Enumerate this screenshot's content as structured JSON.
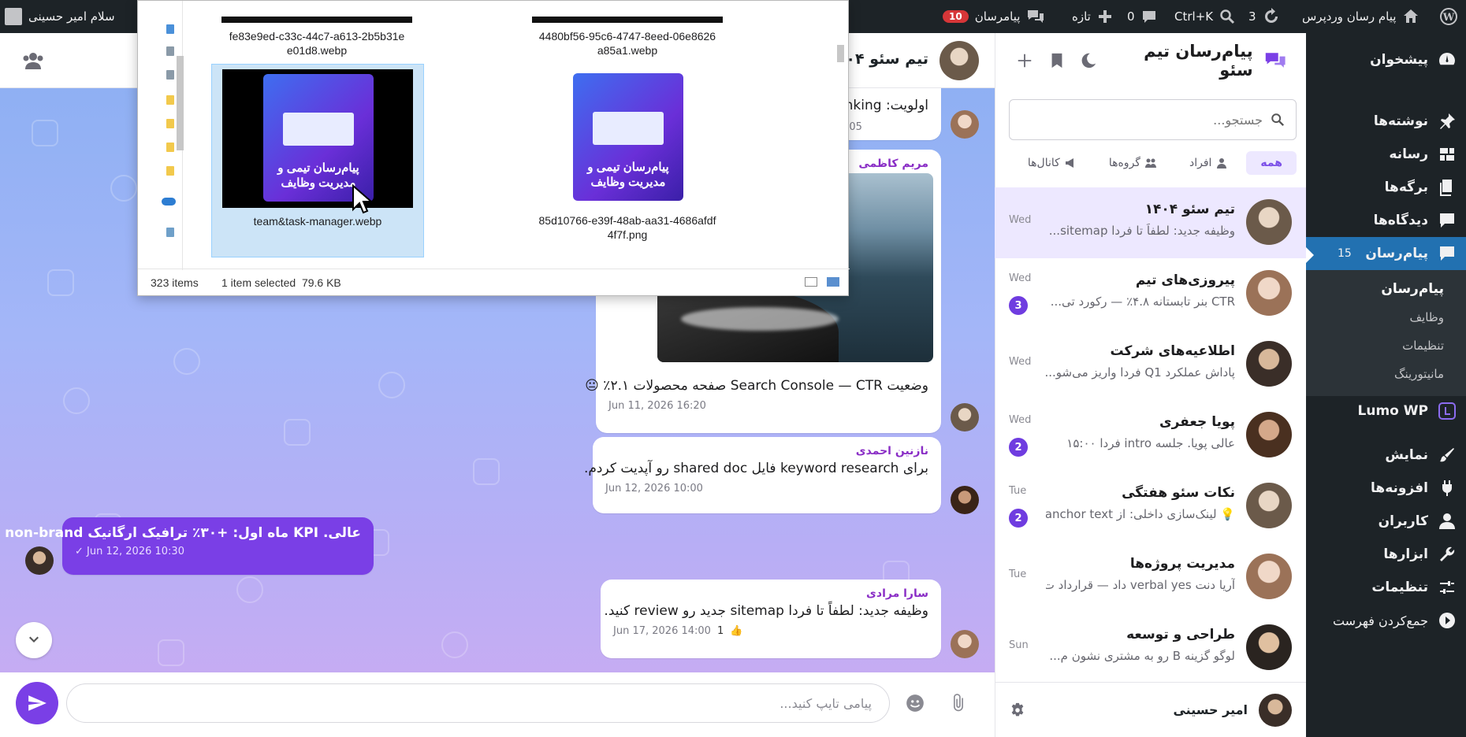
{
  "adminbar": {
    "site_name": "پیام رسان وردپرس",
    "updates_count": "3",
    "search_shortcut": "Ctrl+K",
    "comments_count": "0",
    "new_label": "تازه",
    "messenger_label": "پیامرسان",
    "messenger_badge": "10",
    "greeting": "سلام امیر حسینی"
  },
  "wp_menu": {
    "items": [
      {
        "label": "پیشخوان",
        "icon": "dashboard-icon"
      },
      {
        "label": "نوشته‌ها",
        "icon": "pin-icon"
      },
      {
        "label": "رسانه",
        "icon": "media-icon"
      },
      {
        "label": "برگه‌ها",
        "icon": "pages-icon"
      },
      {
        "label": "دیدگاه‌ها",
        "icon": "comments-icon"
      },
      {
        "label": "پیام‌رسان",
        "icon": "messenger-icon",
        "count": "15"
      },
      {
        "label": "Lumo WP",
        "icon": "lumo-icon"
      },
      {
        "label": "نمایش",
        "icon": "appearance-icon"
      },
      {
        "label": "افزونه‌ها",
        "icon": "plugins-icon"
      },
      {
        "label": "کاربران",
        "icon": "users-icon"
      },
      {
        "label": "ابزارها",
        "icon": "tools-icon"
      },
      {
        "label": "تنظیمات",
        "icon": "settings-icon"
      },
      {
        "label": "جمع‌کردن فهرست",
        "icon": "collapse-icon"
      }
    ],
    "submenu": [
      "پیام‌رسان",
      "وظایف",
      "تنظیمات",
      "مانیتورینگ"
    ]
  },
  "list_panel": {
    "title": "پیام‌رسان تیم سئو",
    "search_placeholder": "جستجو...",
    "tabs": [
      "همه",
      "افراد",
      "گروه‌ها",
      "کانال‌ها"
    ],
    "chats": [
      {
        "name": "تیم سئو ۱۴۰۴",
        "preview": "وظیفه جدید: لطفاً تا فردا sitemap...",
        "time": "Wed",
        "unread": ""
      },
      {
        "name": "پیروزی‌های تیم",
        "preview": "CTR بنر تابستانه ۴.۸٪ — رکورد تی...",
        "time": "Wed",
        "unread": "3"
      },
      {
        "name": "اطلاعیه‌های شرکت",
        "preview": "پاداش عملکرد Q1 فردا واریز می‌شو...",
        "time": "Wed",
        "unread": ""
      },
      {
        "name": "پویا جعفری",
        "preview": "عالی پویا. جلسه intro فردا ۱۵:۰۰",
        "time": "Wed",
        "unread": "2"
      },
      {
        "name": "نکات سئو هفتگی",
        "preview": "💡 لینک‌سازی داخلی: از anchor text...",
        "time": "Tue",
        "unread": "2"
      },
      {
        "name": "مدیریت پروژه‌ها",
        "preview": "آریا دنت verbal yes داد — قرارداد ت...",
        "time": "Tue",
        "unread": ""
      },
      {
        "name": "طراحی و توسعه",
        "preview": "لوگو گزینه B رو به مشتری نشون م...",
        "time": "Sun",
        "unread": ""
      }
    ],
    "me_name": "امیر حسینی"
  },
  "conversation": {
    "title": "تیم سئو ۱۴۰۴",
    "partial_text": "اولویت: Ranking",
    "partial_time": "Jun 10, 2026 08:05",
    "messages": [
      {
        "sender": "مریم کاظمی",
        "text": "وضعیت Search Console — CTR صفحه محصولات ۲.۱٪ 😐",
        "time": "Jun 11, 2026 16:20"
      },
      {
        "sender": "نازنین احمدی",
        "text": "برای keyword research فایل shared doc رو آپدیت کردم.",
        "time": "Jun 12, 2026 10:00"
      },
      {
        "sender": "",
        "text": "عالی. KPI ماه اول: +۳۰٪ ترافیک ارگانیک non-brand",
        "time": "Jun 12, 2026 10:30"
      },
      {
        "sender": "سارا مرادی",
        "text": "وظیفه جدید: لطفاً تا فردا sitemap جدید رو review کنید.",
        "time": "Jun 17, 2026 14:00",
        "reaction": "👍",
        "reaction_count": "1"
      }
    ],
    "composer_placeholder": "پیامی تایپ کنید..."
  },
  "file_dialog": {
    "files": [
      {
        "name": "fe83e9ed-c33c-44c7-a613-2b5b31ee01d8.webp"
      },
      {
        "name": "4480bf56-95c6-4747-8eed-06e8626a85a1.webp"
      },
      {
        "name": "team&task-manager.webp",
        "box_text": "پیام‌رسان تیمی و مدیریت وظایف"
      },
      {
        "name": "85d10766-e39f-48ab-aa31-4686afdf4f7f.png",
        "box_text": "پیام‌رسان تیمی و مدیریت وظایف"
      }
    ],
    "item_count": "323 items",
    "selection": "1 item selected  79.6 KB"
  },
  "colors": {
    "accent": "#7a3fe6",
    "wp_dark": "#1d2327",
    "wp_blue": "#2271b1"
  }
}
